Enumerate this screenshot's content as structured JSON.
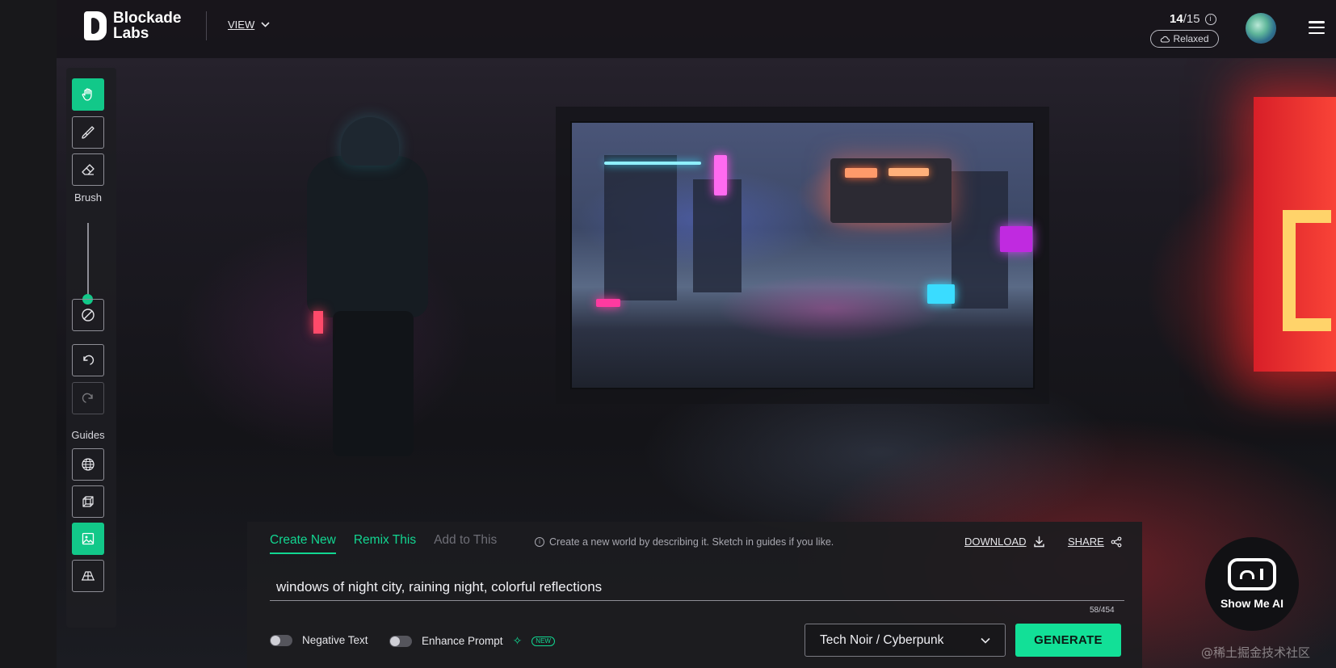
{
  "header": {
    "logo_text": "Blockade\nLabs",
    "view_label": "VIEW",
    "credits_used": "14",
    "credits_total": "/15",
    "mode_badge": "Relaxed"
  },
  "toolbar": {
    "brush_label": "Brush",
    "brush_size_level": 0.1,
    "guides_label": "Guides",
    "active_tool": "hand"
  },
  "prompt_panel": {
    "tabs": [
      {
        "label": "Create New",
        "state": "active"
      },
      {
        "label": "Remix This",
        "state": "normal"
      },
      {
        "label": "Add to This",
        "state": "disabled"
      }
    ],
    "hint": "Create a new world by describing it. Sketch in guides if you like.",
    "download_label": "DOWNLOAD",
    "share_label": "SHARE",
    "prompt_value": "windows of night city, raining night, colorful reflections",
    "char_counter": "58/454",
    "negative_text_label": "Negative Text",
    "enhance_prompt_label": "Enhance Prompt",
    "new_badge": "NEW",
    "style_value": "Tech Noir / Cyberpunk",
    "generate_label": "GENERATE"
  },
  "watermark": {
    "badge_text": "Show Me AI",
    "corner_text": "@稀土掘金技术社区"
  },
  "colors": {
    "accent": "#12e097",
    "panel": "#1c1c20",
    "sign_red": "#e22a2a"
  }
}
